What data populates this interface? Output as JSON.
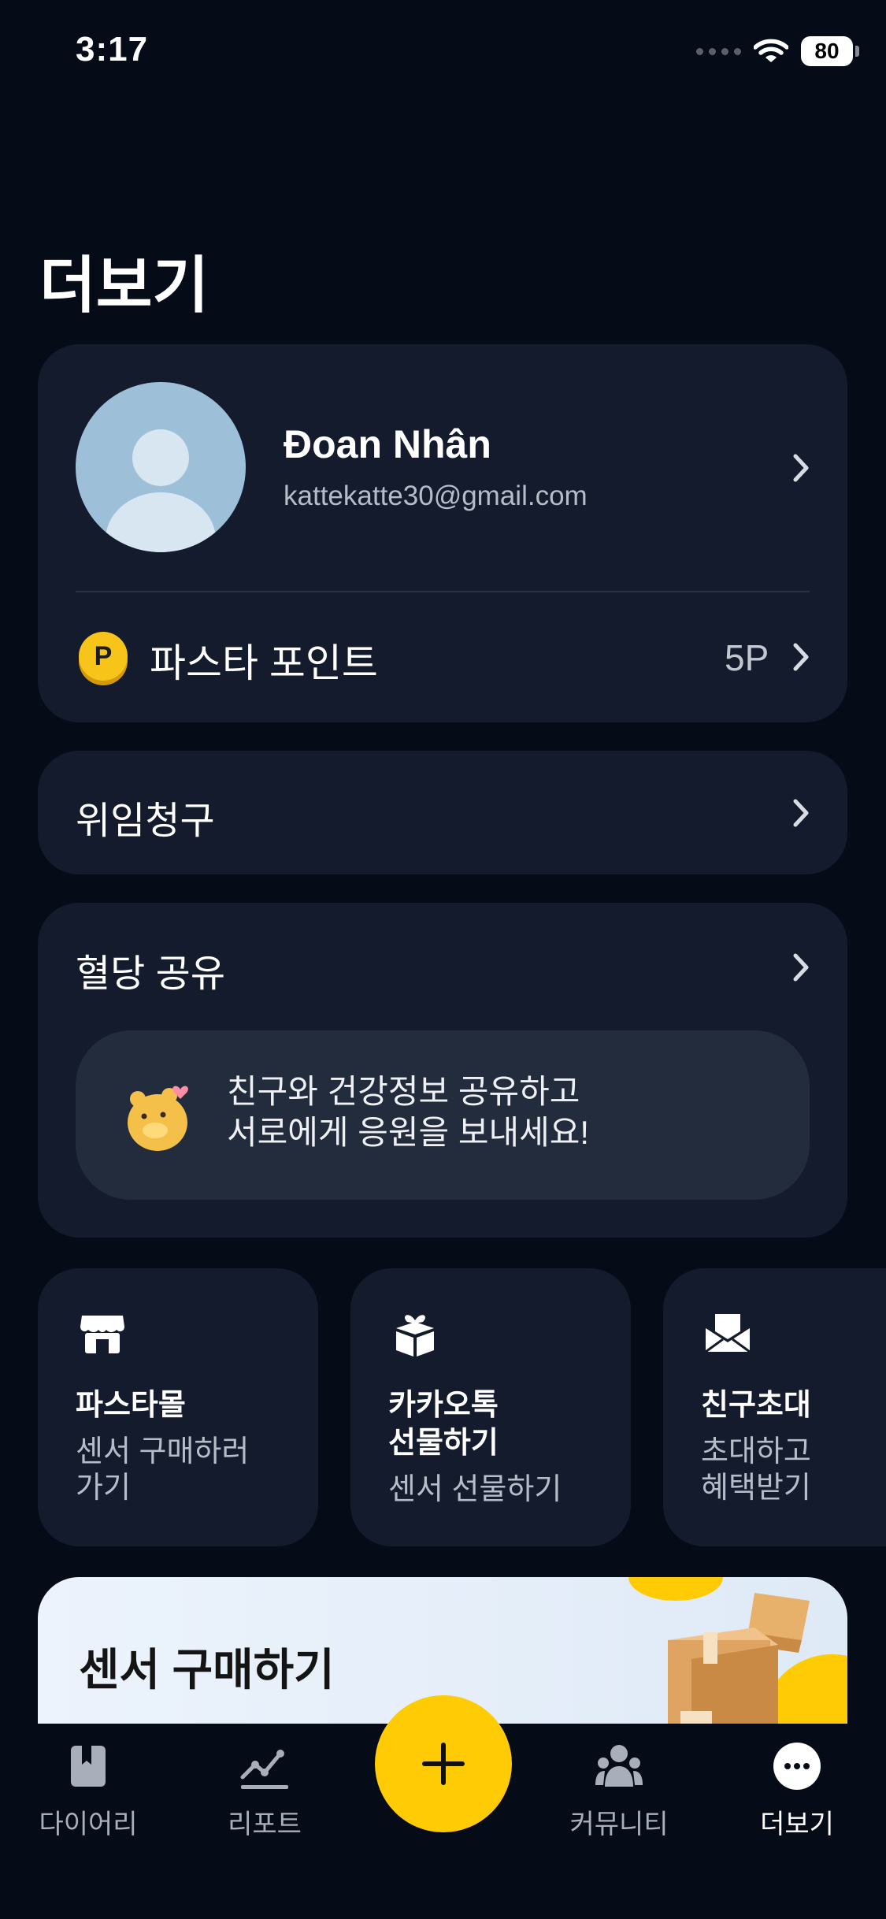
{
  "status_bar": {
    "time": "3:17",
    "battery": "80"
  },
  "page": {
    "title": "더보기"
  },
  "profile": {
    "name": "Đoan Nhân",
    "email": "kattekatte30@gmail.com",
    "points_label": "파스타 포인트",
    "points_icon_letter": "P",
    "points_value": "5P"
  },
  "claim": {
    "label": "위임청구"
  },
  "share": {
    "label": "혈당 공유",
    "banner_line1": "친구와 건강정보 공유하고",
    "banner_line2": "서로에게 응원을 보내세요!"
  },
  "tiles": [
    {
      "icon": "store-icon",
      "title": "파스타몰",
      "subtitle_line1": "센서 구매하러",
      "subtitle_line2": "가기"
    },
    {
      "icon": "gift-box-icon",
      "title_line1": "카카오톡",
      "title_line2": "선물하기",
      "subtitle": "센서 선물하기"
    },
    {
      "icon": "invite-envelope-icon",
      "title": "친구초대",
      "subtitle_line1": "초대하고",
      "subtitle_line2": "혜택받기"
    }
  ],
  "sensor_banner": {
    "title": "센서 구매하기"
  },
  "nav": {
    "items": [
      {
        "label": "다이어리",
        "icon": "diary-icon"
      },
      {
        "label": "리포트",
        "icon": "report-chart-icon"
      },
      {
        "label": "커뮤니티",
        "icon": "community-icon"
      },
      {
        "label": "더보기",
        "icon": "more-icon"
      }
    ],
    "active": "더보기",
    "fab_icon": "plus-icon"
  },
  "colors": {
    "background": "#060b18",
    "card": "#141b2d",
    "accent_yellow": "#ffcb05",
    "muted_text": "#b6bdc9"
  }
}
